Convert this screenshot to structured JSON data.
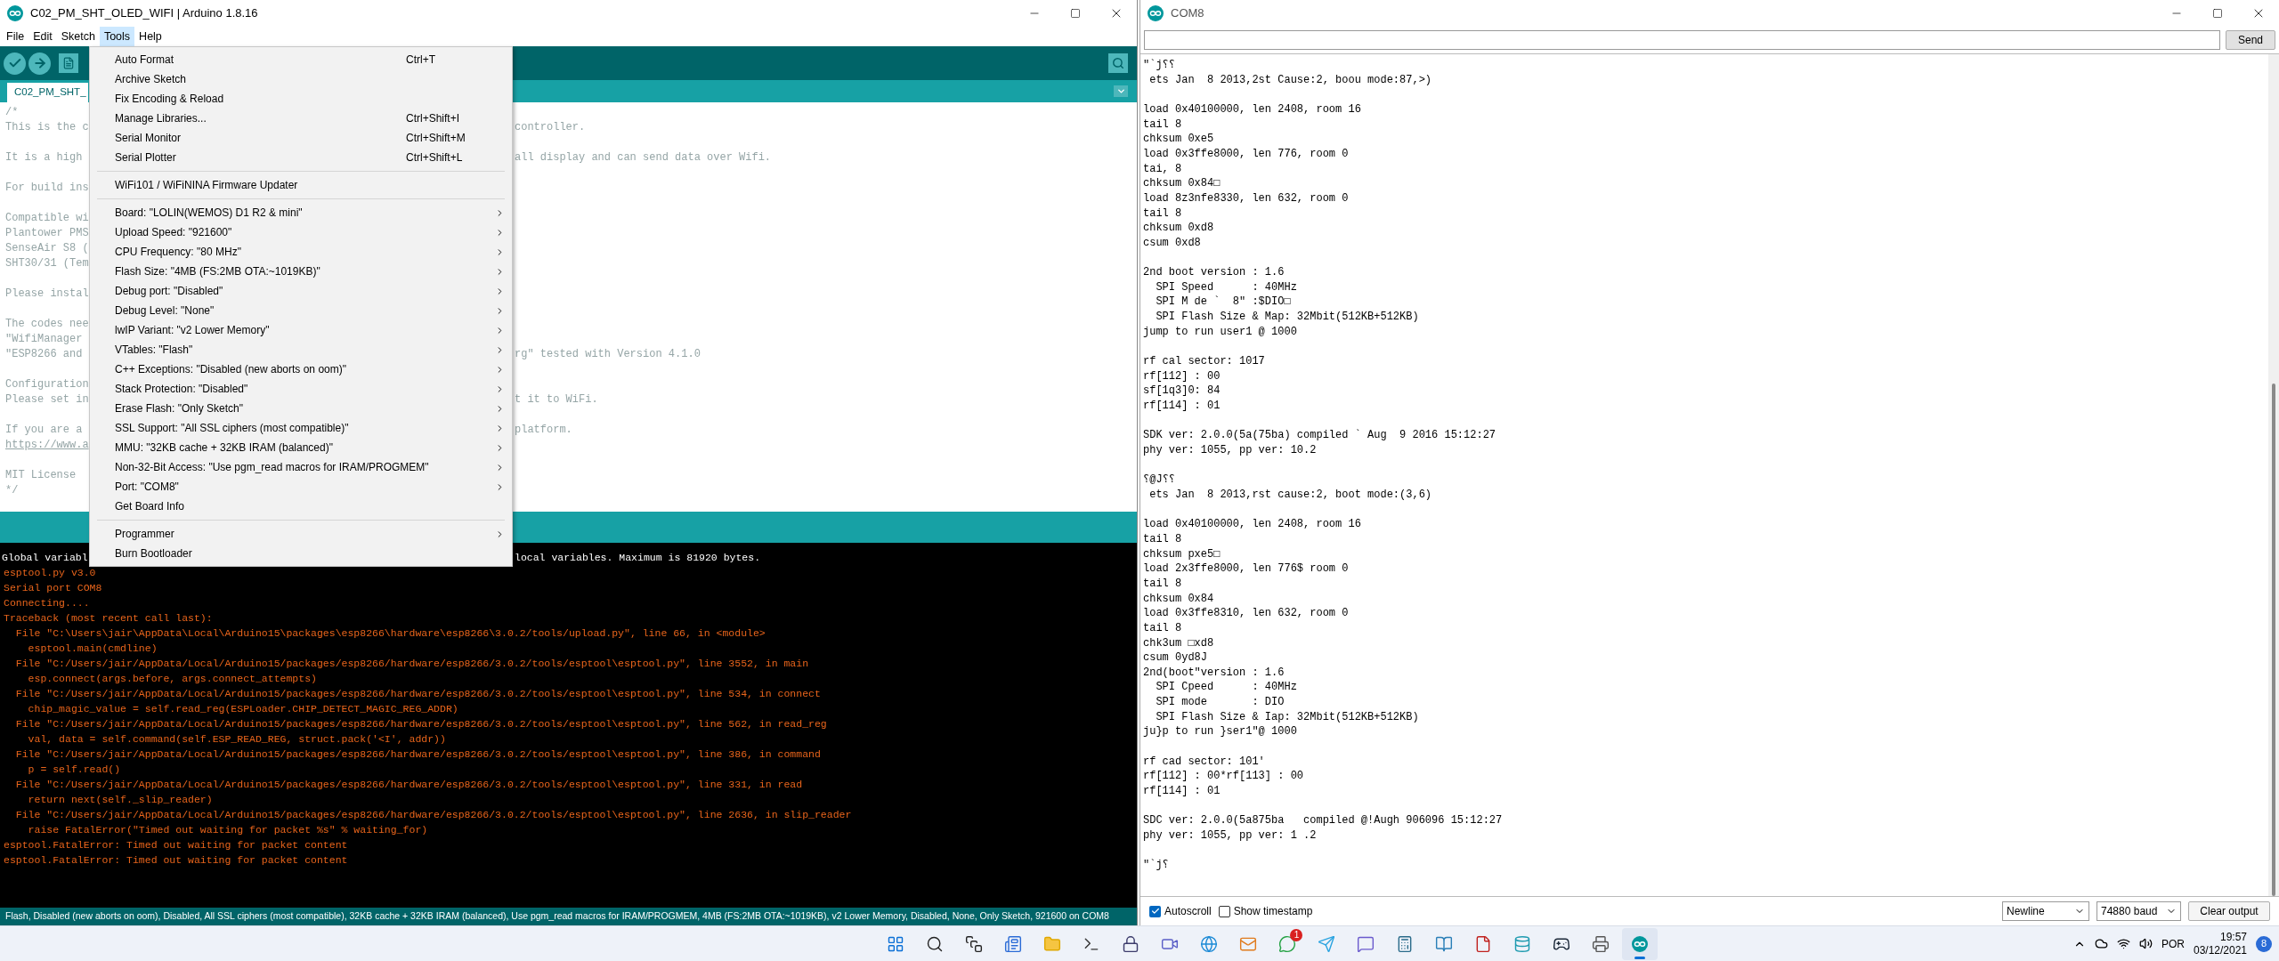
{
  "ide": {
    "title": "C02_PM_SHT_OLED_WIFI | Arduino 1.8.16",
    "menus": [
      {
        "label": "File",
        "selected": false
      },
      {
        "label": "Edit",
        "selected": false
      },
      {
        "label": "Sketch",
        "selected": false
      },
      {
        "label": "Tools",
        "selected": true
      },
      {
        "label": "Help",
        "selected": false
      }
    ],
    "tab": "C02_PM_SHT_",
    "editor_blocks": [
      [
        {
          "text": "/*"
        },
        {
          "text": "This is the c",
          "right": "controller."
        }
      ],
      [
        {
          "text": "It is a high",
          "right": "all display and can send data over Wifi."
        }
      ],
      [
        {
          "text": "For build ins"
        }
      ],
      [
        {
          "text": "Compatible wi"
        },
        {
          "text": "Plantower PMS"
        },
        {
          "text": "SenseAir S8 ("
        },
        {
          "text": "SHT30/31 (Tem"
        }
      ],
      [
        {
          "text": "Please instal"
        }
      ],
      [
        {
          "text": "The codes nee"
        },
        {
          "text": "\"WifiManager"
        },
        {
          "text": "\"ESP8266 and",
          "right": "rg\" tested with Version 4.1.0"
        }
      ],
      [
        {
          "text": "Configuration"
        },
        {
          "text": "Please set in",
          "right": "t it to WiFi."
        }
      ],
      [
        {
          "text": "If you are a",
          "right": "platform."
        },
        {
          "text": "https://www.a",
          "kind": "link"
        }
      ],
      [
        {
          "text": "MIT License"
        },
        {
          "text": "*/"
        }
      ]
    ],
    "tools_menu": [
      {
        "kind": "item",
        "label": "Auto Format",
        "shortcut": "Ctrl+T"
      },
      {
        "kind": "item",
        "label": "Archive Sketch"
      },
      {
        "kind": "item",
        "label": "Fix Encoding & Reload"
      },
      {
        "kind": "item",
        "label": "Manage Libraries...",
        "shortcut": "Ctrl+Shift+I"
      },
      {
        "kind": "item",
        "label": "Serial Monitor",
        "shortcut": "Ctrl+Shift+M"
      },
      {
        "kind": "item",
        "label": "Serial Plotter",
        "shortcut": "Ctrl+Shift+L"
      },
      {
        "kind": "separator"
      },
      {
        "kind": "item",
        "label": "WiFi101 / WiFiNINA Firmware Updater"
      },
      {
        "kind": "separator"
      },
      {
        "kind": "submenu",
        "label": "Board: \"LOLIN(WEMOS) D1 R2 & mini\""
      },
      {
        "kind": "submenu",
        "label": "Upload Speed: \"921600\""
      },
      {
        "kind": "submenu",
        "label": "CPU Frequency: \"80 MHz\""
      },
      {
        "kind": "submenu",
        "label": "Flash Size: \"4MB (FS:2MB OTA:~1019KB)\""
      },
      {
        "kind": "submenu",
        "label": "Debug port: \"Disabled\""
      },
      {
        "kind": "submenu",
        "label": "Debug Level: \"None\""
      },
      {
        "kind": "submenu",
        "label": "lwIP Variant: \"v2 Lower Memory\""
      },
      {
        "kind": "submenu",
        "label": "VTables: \"Flash\""
      },
      {
        "kind": "submenu",
        "label": "C++ Exceptions: \"Disabled (new aborts on oom)\""
      },
      {
        "kind": "submenu",
        "label": "Stack Protection: \"Disabled\""
      },
      {
        "kind": "submenu",
        "label": "Erase Flash: \"Only Sketch\""
      },
      {
        "kind": "submenu",
        "label": "SSL Support: \"All SSL ciphers (most compatible)\""
      },
      {
        "kind": "submenu",
        "label": "MMU: \"32KB cache + 32KB IRAM (balanced)\""
      },
      {
        "kind": "submenu",
        "label": "Non-32-Bit Access: \"Use pgm_read macros for IRAM/PROGMEM\""
      },
      {
        "kind": "submenu",
        "label": "Port: \"COM8\""
      },
      {
        "kind": "item",
        "label": "Get Board Info"
      },
      {
        "kind": "separator"
      },
      {
        "kind": "submenu",
        "label": "Programmer"
      },
      {
        "kind": "item",
        "label": "Burn Bootloader"
      }
    ],
    "console_lines": [
      {
        "kind": "info",
        "text": "Global variabl",
        "right": "local variables. Maximum is 81920 bytes."
      },
      {
        "kind": "error",
        "text": "esptool.py v3.0"
      },
      {
        "kind": "error",
        "text": "Serial port COM8"
      },
      {
        "kind": "error",
        "text": "Connecting...."
      },
      {
        "kind": "error",
        "text": "Traceback (most recent call last):"
      },
      {
        "kind": "error",
        "text": "  File \"C:\\Users\\jair\\AppData\\Local\\Arduino15\\packages\\esp8266\\hardware\\esp8266\\3.0.2/tools/upload.py\", line 66, in <module>"
      },
      {
        "kind": "error",
        "text": "    esptool.main(cmdline)"
      },
      {
        "kind": "error",
        "text": "  File \"C:/Users/jair/AppData/Local/Arduino15/packages/esp8266/hardware/esp8266/3.0.2/tools/esptool\\esptool.py\", line 3552, in main"
      },
      {
        "kind": "error",
        "text": "    esp.connect(args.before, args.connect_attempts)"
      },
      {
        "kind": "error",
        "text": "  File \"C:/Users/jair/AppData/Local/Arduino15/packages/esp8266/hardware/esp8266/3.0.2/tools/esptool\\esptool.py\", line 534, in connect"
      },
      {
        "kind": "error",
        "text": "    chip_magic_value = self.read_reg(ESPLoader.CHIP_DETECT_MAGIC_REG_ADDR)"
      },
      {
        "kind": "error",
        "text": "  File \"C:/Users/jair/AppData/Local/Arduino15/packages/esp8266/hardware/esp8266/3.0.2/tools/esptool\\esptool.py\", line 562, in read_reg"
      },
      {
        "kind": "error",
        "text": "    val, data = self.command(self.ESP_READ_REG, struct.pack('<I', addr))"
      },
      {
        "kind": "error",
        "text": "  File \"C:/Users/jair/AppData/Local/Arduino15/packages/esp8266/hardware/esp8266/3.0.2/tools/esptool\\esptool.py\", line 386, in command"
      },
      {
        "kind": "error",
        "text": "    p = self.read()"
      },
      {
        "kind": "error",
        "text": "  File \"C:/Users/jair/AppData/Local/Arduino15/packages/esp8266/hardware/esp8266/3.0.2/tools/esptool\\esptool.py\", line 331, in read"
      },
      {
        "kind": "error",
        "text": "    return next(self._slip_reader)"
      },
      {
        "kind": "error",
        "text": "  File \"C:/Users/jair/AppData/Local/Arduino15/packages/esp8266/hardware/esp8266/3.0.2/tools/esptool\\esptool.py\", line 2636, in slip_reader"
      },
      {
        "kind": "error",
        "text": "    raise FatalError(\"Timed out waiting for packet %s\" % waiting_for)"
      },
      {
        "kind": "error",
        "text": "esptool.FatalError: Timed out waiting for packet content"
      },
      {
        "kind": "error",
        "text": "esptool.FatalError: Timed out waiting for packet content"
      }
    ],
    "status_bar": "Flash, Disabled (new aborts on oom), Disabled, All SSL ciphers (most compatible), 32KB cache + 32KB IRAM (balanced), Use pgm_read macros for IRAM/PROGMEM, 4MB (FS:2MB OTA:~1019KB), v2 Lower Memory, Disabled, None, Only Sketch, 921600 on COM8"
  },
  "serial_monitor": {
    "title": "COM8",
    "send": "Send",
    "blocks": [
      [
        "\"`j⸮⸮",
        " ets Jan  8 2013,2st Cause:2, boou mode:87,>)"
      ],
      [
        "load 0x40100000, len 2408, room 16",
        "tail 8",
        "chksum 0xe5",
        "load 0x3ffe8000, len 776, room 0",
        "tai, 8",
        "chksum 0x84□",
        "load 8z3nfe8330, len 632, room 0",
        "tail 8",
        "chksum 0xd8",
        "csum 0xd8"
      ],
      [
        "2nd boot version : 1.6",
        "  SPI Speed      : 40MHz",
        "  SPI M de `  8\" :$DIO□",
        "  SPI Flash Size & Map: 32Mbit(512KB+512KB)",
        "jump to run user1 @ 1000"
      ],
      [
        "rf cal sector: 1017",
        "rf[112] : 00",
        "sf[1q3]0: 84",
        "rf[114] : 01"
      ],
      [
        "SDK ver: 2.0.0(5a(75ba) compiled ` Aug  9 2016 15:12:27",
        "phy ver: 1055, pp ver: 10.2"
      ],
      [
        "⸮@J⸮⸮",
        " ets Jan  8 2013,rst cause:2, boot mode:(3,6)"
      ],
      [
        "load 0x40100000, len 2408, room 16",
        "tail 8",
        "chksum pxe5□",
        "load 2x3ffe8000, len 776$ room 0",
        "tail 8",
        "chksum 0x84",
        "load 0x3ffe8310, len 632, room 0",
        "tail 8",
        "chk3um □xd8",
        "csum 0yd8J",
        "2nd(boot\"version : 1.6",
        "  SPI Cpeed      : 40MHz",
        "  SPI mode       : DIO",
        "  SPI Flash Size & Iap: 32Mbit(512KB+512KB)",
        "ju}p to run }ser1\"@ 1000"
      ],
      [
        "rf cad sector: 101'",
        "rf[112] : 00*rf[113] : 00",
        "rf[114] : 01"
      ],
      [
        "SDC ver: 2.0.0(5a875ba   compiled @!Augh 906096 15:12:27",
        "phy ver: 1055, pp ver: 1 .2"
      ],
      [
        "\"`j⸮"
      ]
    ],
    "autoscroll": {
      "label": "Autoscroll",
      "checked": true
    },
    "timestamp": {
      "label": "Show timestamp",
      "checked": false
    },
    "line_ending": "Newline",
    "baud": "74880 baud",
    "clear": "Clear output"
  },
  "taskbar": {
    "apps": [
      {
        "kind": "start",
        "selected": false
      },
      {
        "kind": "search",
        "selected": false
      },
      {
        "kind": "taskview",
        "selected": false
      },
      {
        "kind": "widgets",
        "selected": false
      },
      {
        "kind": "folder",
        "selected": false
      },
      {
        "kind": "terminal",
        "selected": false
      },
      {
        "kind": "lock",
        "selected": false
      },
      {
        "kind": "video",
        "selected": false
      },
      {
        "kind": "browser",
        "selected": false
      },
      {
        "kind": "mail",
        "selected": false
      },
      {
        "kind": "chat",
        "selected": false,
        "badge": "1"
      },
      {
        "kind": "send",
        "selected": false
      },
      {
        "kind": "message",
        "selected": false
      },
      {
        "kind": "calculator",
        "selected": false
      },
      {
        "kind": "book",
        "selected": false
      },
      {
        "kind": "document",
        "selected": false
      },
      {
        "kind": "database",
        "selected": false
      },
      {
        "kind": "gamepad",
        "selected": false
      },
      {
        "kind": "printer",
        "selected": false
      },
      {
        "kind": "arduino",
        "selected": true
      }
    ],
    "language": "POR",
    "time": "19:57",
    "date": "03/12/2021",
    "notifications": "8"
  }
}
